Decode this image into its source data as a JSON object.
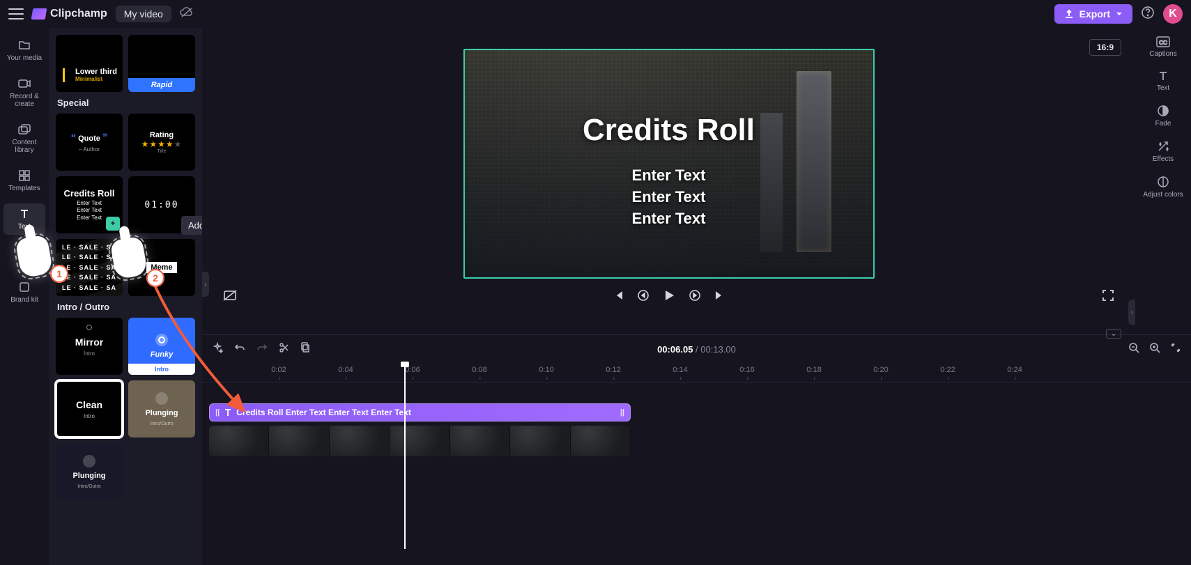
{
  "header": {
    "app_name": "Clipchamp",
    "video_title": "My video",
    "export_label": "Export",
    "avatar_letter": "K",
    "aspect_ratio": "16:9"
  },
  "nav": {
    "your_media": "Your media",
    "record_create": "Record & create",
    "content_library": "Content library",
    "templates": "Templates",
    "text": "Text",
    "brand_kit": "Brand kit"
  },
  "panel": {
    "sections": {
      "special": "Special",
      "intro_outro": "Intro / Outro"
    },
    "cards": {
      "lower_third": "Lower third",
      "lower_third_sub": "Minimalist",
      "rapid": "Rapid",
      "quote": "Quote",
      "quote_author": "– Author",
      "rating": "Rating",
      "rating_sub": "Title",
      "credits_title": "Credits Roll",
      "credits_line": "Enter Text",
      "countdown": "01:00",
      "sale": "LE · SALE · SA",
      "meme": "Meme",
      "mirror": "Mirror",
      "mirror_sub": "Intro",
      "funky": "Funky",
      "funky_sub": "Intro",
      "clean": "Clean",
      "clean_sub": "Intro",
      "plunging": "Plunging",
      "plunging_sub": "Intro/Outro"
    },
    "tooltip": "Add to timeline"
  },
  "right_rail": {
    "captions": "Captions",
    "text": "Text",
    "fade": "Fade",
    "effects": "Effects",
    "adjust_colors": "Adjust colors"
  },
  "stage": {
    "title": "Credits Roll",
    "lines": [
      "Enter Text",
      "Enter Text",
      "Enter Text"
    ]
  },
  "timeline": {
    "current": "00:06.05",
    "duration": "00:13.00",
    "ticks": [
      "0:02",
      "0:04",
      "0:06",
      "0:08",
      "0:10",
      "0:12",
      "0:14",
      "0:16",
      "0:18",
      "0:20",
      "0:22",
      "0:24"
    ],
    "text_clip_label": "Credits Roll Enter Text Enter Text Enter Text"
  },
  "tutorial": {
    "step1": "1",
    "step2": "2"
  }
}
